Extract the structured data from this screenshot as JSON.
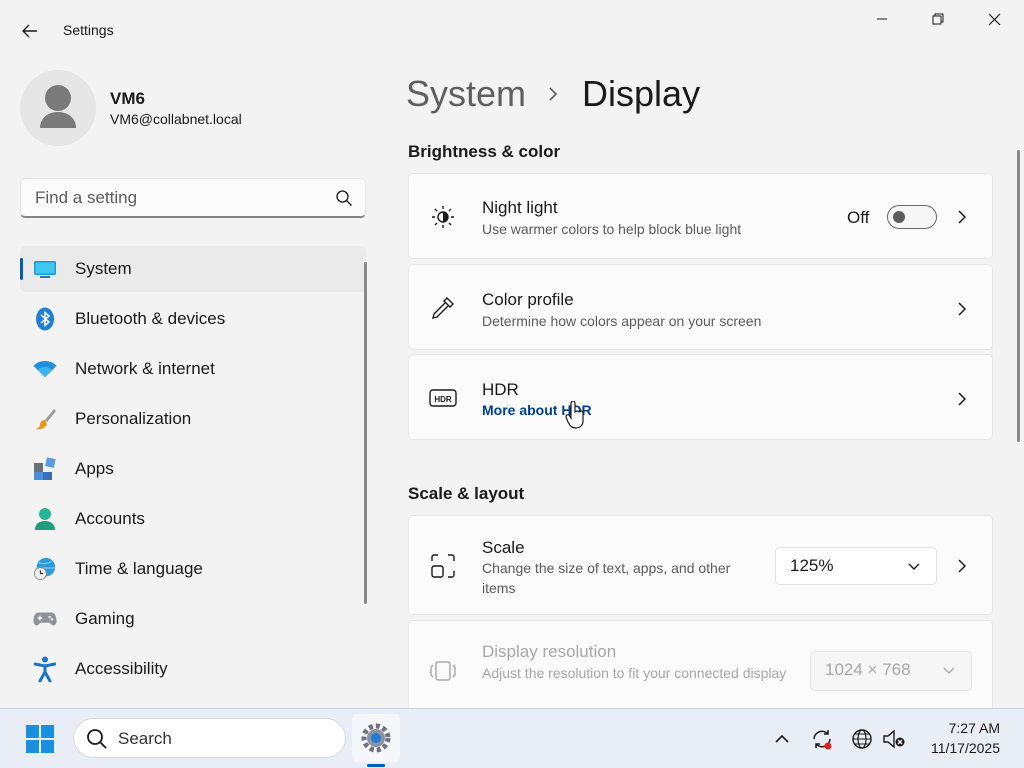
{
  "window": {
    "app_title": "Settings"
  },
  "user": {
    "name": "VM6",
    "email": "VM6@collabnet.local"
  },
  "search": {
    "placeholder": "Find a setting"
  },
  "sidebar": {
    "items": [
      {
        "label": "System",
        "icon": "system-icon",
        "selected": true
      },
      {
        "label": "Bluetooth & devices",
        "icon": "bluetooth-icon"
      },
      {
        "label": "Network & internet",
        "icon": "wifi-icon"
      },
      {
        "label": "Personalization",
        "icon": "paintbrush-icon"
      },
      {
        "label": "Apps",
        "icon": "apps-icon"
      },
      {
        "label": "Accounts",
        "icon": "person-icon"
      },
      {
        "label": "Time & language",
        "icon": "globe-clock-icon"
      },
      {
        "label": "Gaming",
        "icon": "gamepad-icon"
      },
      {
        "label": "Accessibility",
        "icon": "accessibility-icon"
      }
    ]
  },
  "breadcrumb": {
    "parent": "System",
    "current": "Display"
  },
  "sections": {
    "brightness": {
      "title": "Brightness & color",
      "night_light": {
        "title": "Night light",
        "desc": "Use warmer colors to help block blue light",
        "state": "Off"
      },
      "color_profile": {
        "title": "Color profile",
        "desc": "Determine how colors appear on your screen"
      },
      "hdr": {
        "title": "HDR",
        "link": "More about HDR"
      }
    },
    "scale_layout": {
      "title": "Scale & layout",
      "scale": {
        "title": "Scale",
        "desc": "Change the size of text, apps, and other items",
        "value": "125%"
      },
      "resolution": {
        "title": "Display resolution",
        "desc": "Adjust the resolution to fit your connected display",
        "value": "1024 × 768"
      }
    }
  },
  "taskbar": {
    "search_label": "Search"
  },
  "clock": {
    "time": "7:27 AM",
    "date": "11/17/2025"
  },
  "colors": {
    "accent": "#005fb8",
    "link": "#003e92"
  }
}
